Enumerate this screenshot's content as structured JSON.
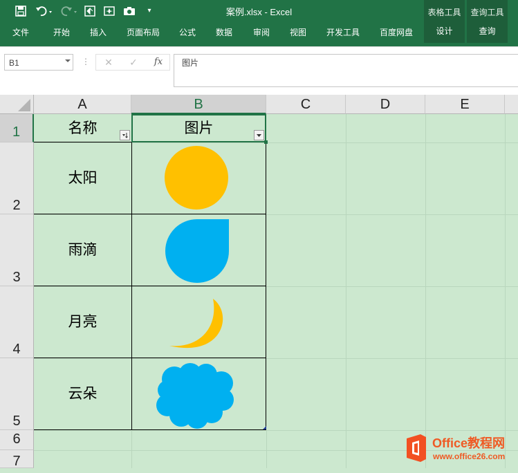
{
  "title_bar": {
    "title": "案例.xlsx - Excel",
    "context_groups": [
      {
        "group": "表格工具",
        "tab": "设计"
      },
      {
        "group": "查询工具",
        "tab": "查询"
      }
    ]
  },
  "ribbon": {
    "tabs": [
      "文件",
      "开始",
      "插入",
      "页面布局",
      "公式",
      "数据",
      "审阅",
      "视图",
      "开发工具",
      "百度网盘"
    ]
  },
  "formula_bar": {
    "name_box": "B1",
    "cancel_glyph": "✕",
    "enter_glyph": "✓",
    "fx_glyph": "fx",
    "content": "图片"
  },
  "sheet": {
    "columns": [
      "A",
      "B",
      "C",
      "D",
      "E"
    ],
    "rows": [
      "1",
      "2",
      "3",
      "4",
      "5",
      "6",
      "7"
    ],
    "headers": [
      "名称",
      "图片"
    ],
    "items": [
      {
        "name": "太阳",
        "shape": "sun-circle",
        "color": "#ffc000"
      },
      {
        "name": "雨滴",
        "shape": "raindrop",
        "color": "#00b0f0"
      },
      {
        "name": "月亮",
        "shape": "crescent-moon",
        "color": "#ffc000"
      },
      {
        "name": "云朵",
        "shape": "cloud",
        "color": "#00b0f0"
      }
    ]
  },
  "watermark": {
    "brand": "Office教程网",
    "url": "www.office26.com"
  },
  "colors": {
    "excel_green": "#217346",
    "sheet_bg": "#cce8cf",
    "logo_orange": "#f25022"
  }
}
